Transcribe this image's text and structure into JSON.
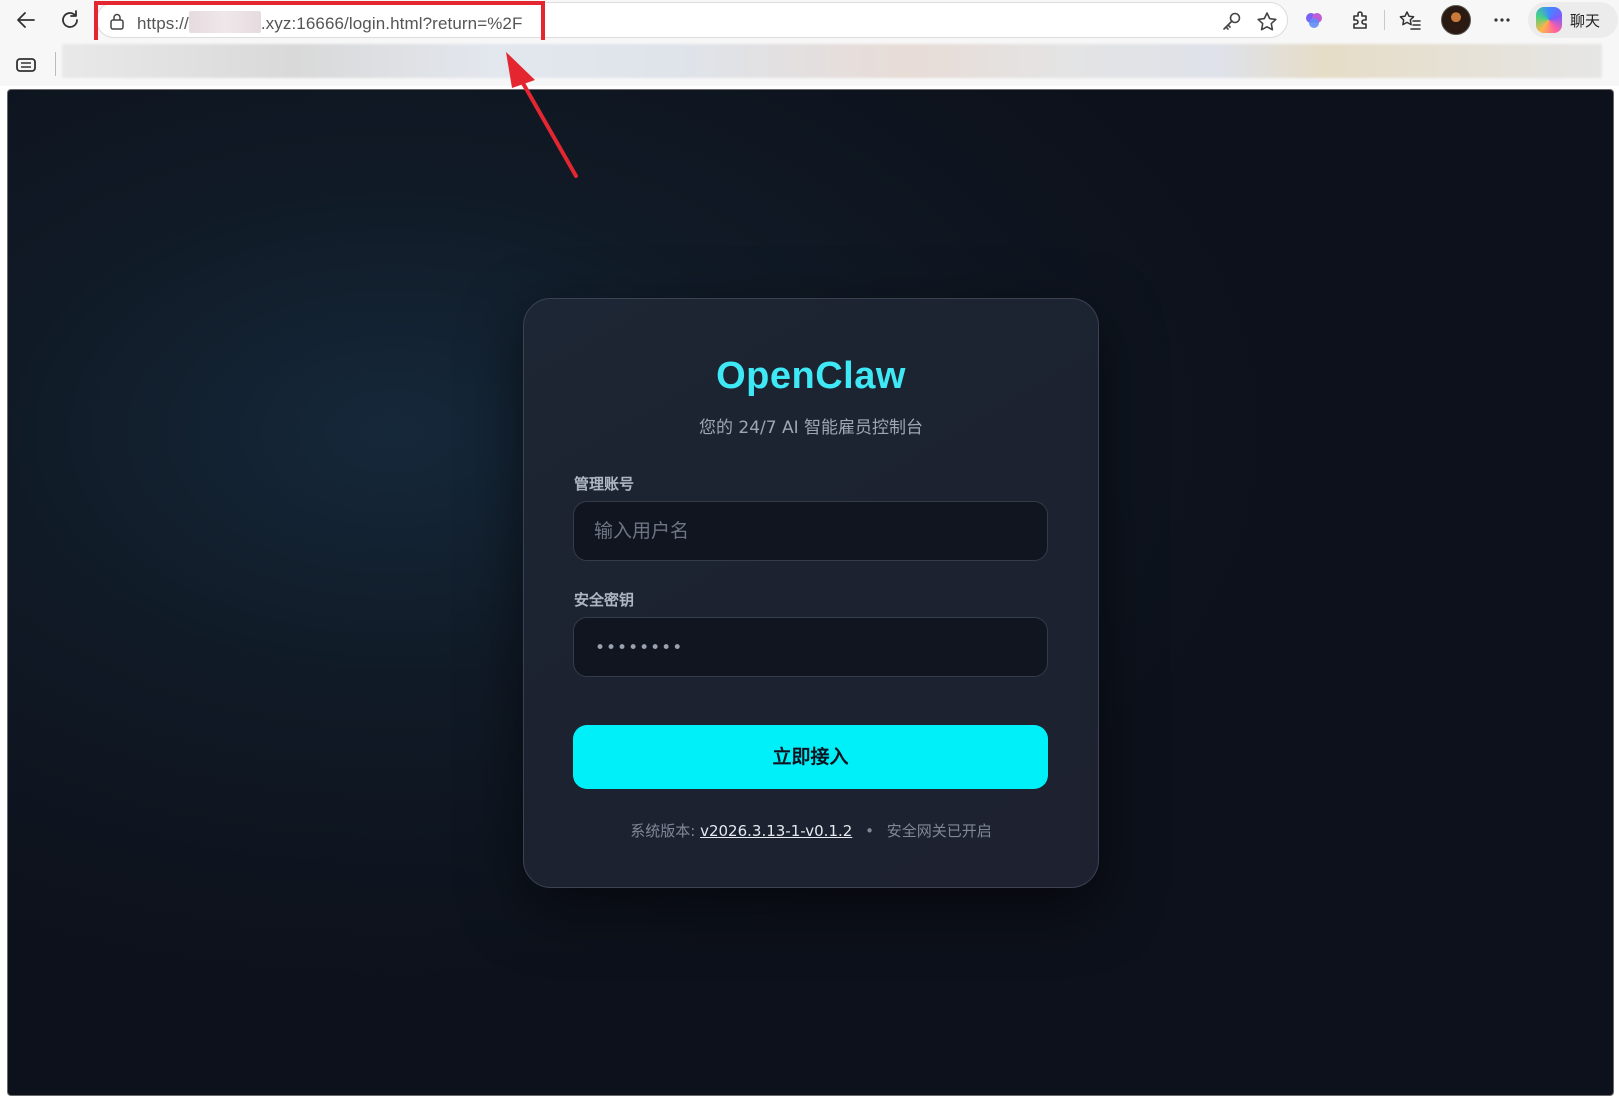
{
  "browser": {
    "url": {
      "prefix": "https://",
      "suffix": ".xyz:16666/login.html?return=%2F"
    },
    "chat_label": "聊天",
    "icons": {
      "back": "back-arrow-icon",
      "reload": "reload-icon",
      "lock": "lock-icon",
      "password_key": "key-icon",
      "favorite": "star-icon",
      "brain": "brain-extension-icon",
      "extensions": "puzzle-icon",
      "favorites": "favorites-icon",
      "more": "more-icon",
      "copilot": "copilot-icon"
    }
  },
  "login": {
    "brand": "OpenClaw",
    "subtitle": "您的 24/7 AI 智能雇员控制台",
    "username": {
      "label": "管理账号",
      "placeholder": "输入用户名"
    },
    "password": {
      "label": "安全密钥",
      "value_mask": "••••••••"
    },
    "submit_label": "立即接入",
    "footer": {
      "version_prefix": "系统版本:",
      "version": "v2026.3.13-1-v0.1.2",
      "separator": "•",
      "status": "安全网关已开启"
    }
  },
  "colors": {
    "accent": "#00f0fa",
    "brand": "#3ee8f4",
    "highlight": "#e3262f"
  }
}
